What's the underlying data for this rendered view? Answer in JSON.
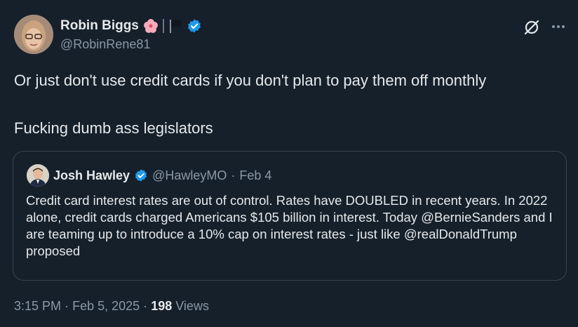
{
  "author": {
    "display_name": "Robin Biggs",
    "handle": "@RobinRene81",
    "verified": true,
    "badge_emojis": [
      "hibiscus-icon",
      "black-flag-icon"
    ]
  },
  "tweet": {
    "paragraphs": [
      "Or just don't use credit cards if you don't plan to pay them off monthly",
      "Fucking dumb ass legislators"
    ]
  },
  "quoted": {
    "display_name": "Josh Hawley",
    "handle": "@HawleyMO",
    "separator": "·",
    "date": "Feb 4",
    "verified": true,
    "text": "Credit card interest rates are out of control. Rates have DOUBLED in recent years. In 2022 alone, credit cards charged Americans $105 billion in interest. Today @BernieSanders and I are teaming up to introduce a 10% cap on interest rates - just like @realDonaldTrump proposed"
  },
  "footer": {
    "time": "3:15 PM",
    "date": "Feb 5, 2025",
    "separator": "·",
    "views_count": "198",
    "views_label": "Views"
  },
  "colors": {
    "background": "#15202b",
    "text_primary": "#e7e9ea",
    "text_secondary": "#8b98a5",
    "verified_blue": "#1d9bf0",
    "border": "#38444d"
  }
}
